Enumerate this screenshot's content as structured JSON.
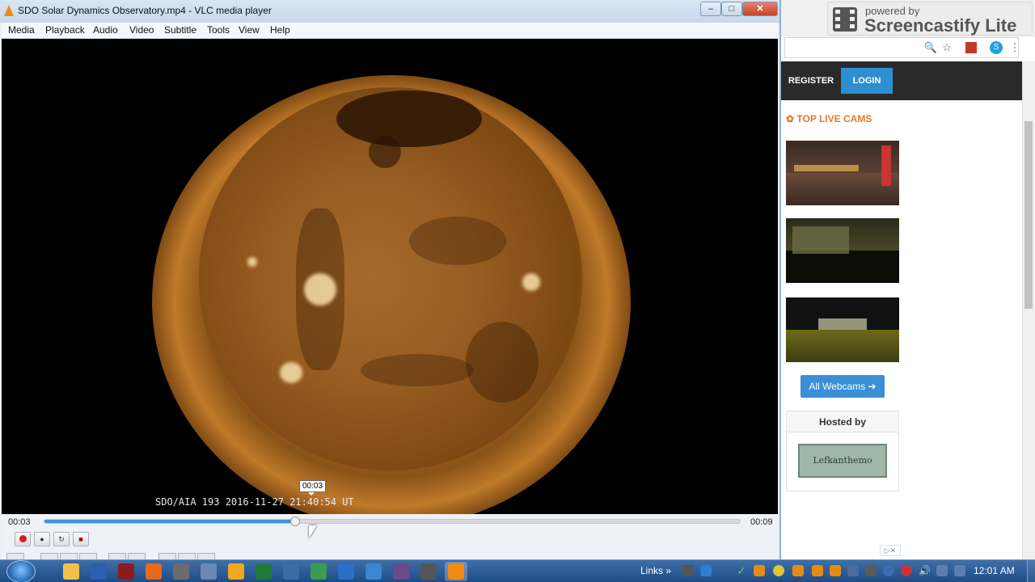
{
  "browser": {
    "nav": {
      "register": "REGISTER",
      "login": "LOGIN"
    },
    "top_live_cams": "TOP LIVE CAMS",
    "all_webcams": "All Webcams ➔",
    "hosted_by": "Hosted by",
    "sponsor_logo_text": "Lefkanthemo",
    "ad_badge": "▷✕"
  },
  "screencastify": {
    "powered": "powered by",
    "brand": "Screencastify Lite"
  },
  "vlc": {
    "window_title": "SDO  Solar Dynamics Observatory.mp4 - VLC media player",
    "window_buttons": {
      "minimize": "–",
      "maximize": "□",
      "close": "✕"
    },
    "menu": [
      "Media",
      "Playback",
      "Audio",
      "Video",
      "Subtitle",
      "Tools",
      "View",
      "Help"
    ],
    "overlay_text": "SDO/AIA  193   2016-11-27 21:40:54 UT",
    "tooltip": "00:03",
    "elapsed": "00:03",
    "duration": "00:09",
    "progress": 0.36,
    "controls": [
      "record-button",
      "snapshot-button",
      "loop-ab-button",
      "frame-step-button"
    ]
  },
  "taskbar": {
    "links": "Links",
    "clock": "12:01 AM",
    "pinned": [
      "explorer",
      "word",
      "app",
      "firefox",
      "clipboard",
      "monitor",
      "outlook",
      "excel",
      "network",
      "chrome",
      "app2",
      "ie",
      "app3",
      "app4",
      "vlc"
    ]
  },
  "colors": {
    "seek_fill": "#3f93da",
    "taskbar": "#1e4c86",
    "nav_button": "#2e8fd0",
    "accent_orange": "#e07b2a"
  }
}
